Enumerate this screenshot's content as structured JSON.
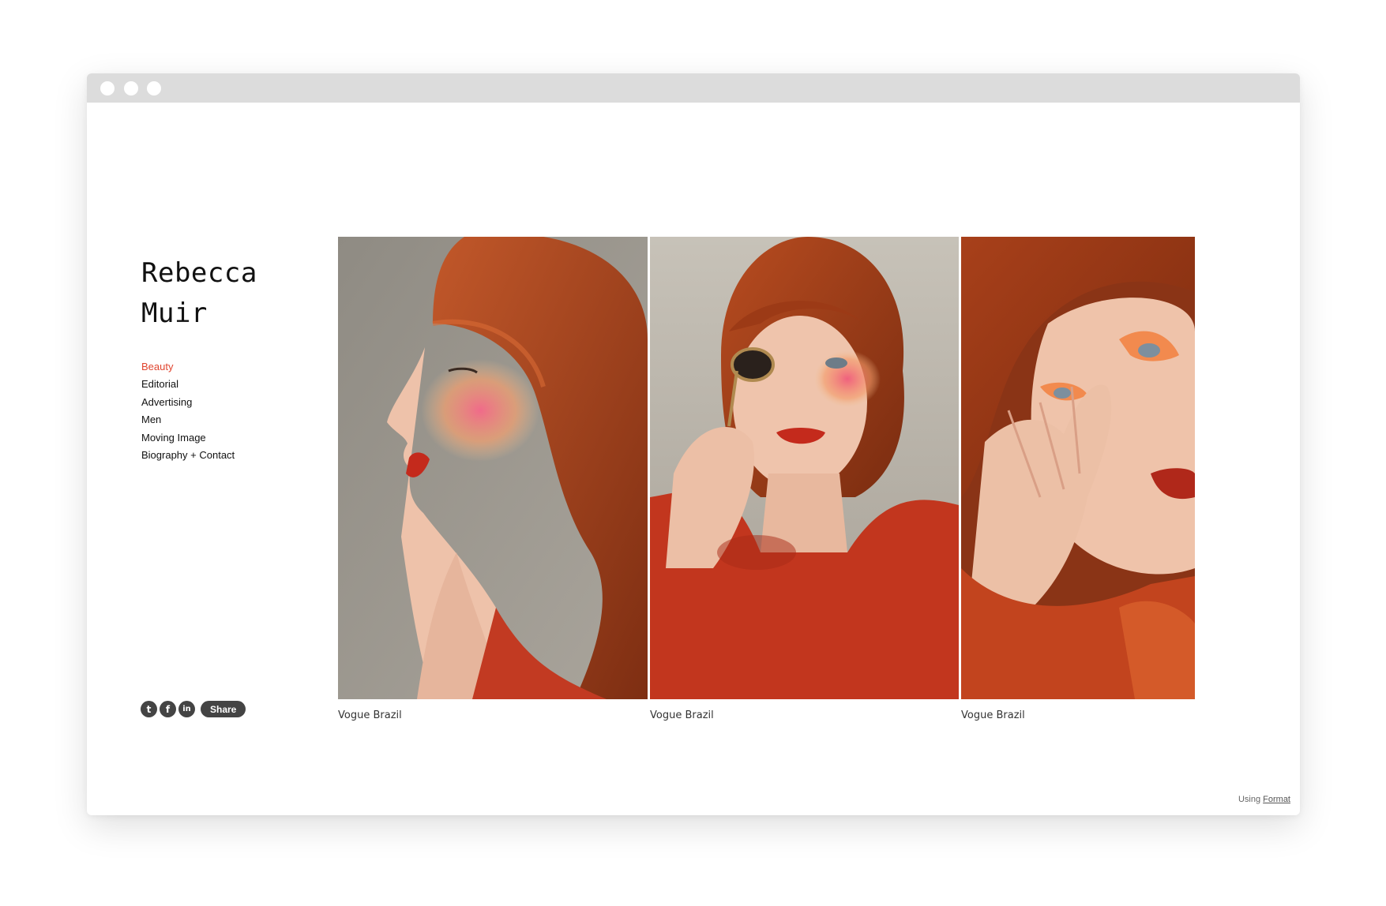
{
  "site": {
    "name_line1": "Rebecca",
    "name_line2": "Muir"
  },
  "nav": {
    "items": [
      {
        "label": "Beauty",
        "active": true
      },
      {
        "label": "Editorial"
      },
      {
        "label": "Advertising"
      },
      {
        "label": "Men"
      },
      {
        "label": "Moving Image"
      },
      {
        "label": "Biography + Contact"
      }
    ]
  },
  "social": {
    "twitter_glyph": "t",
    "facebook_glyph": "f",
    "linkedin_glyph": "in",
    "share_label": "Share"
  },
  "gallery": {
    "items": [
      {
        "caption": "Vogue Brazil"
      },
      {
        "caption": "Vogue Brazil"
      },
      {
        "caption": "Vogue Brazil"
      }
    ]
  },
  "footer": {
    "using_text": "Using",
    "format_link": "Format"
  },
  "colors": {
    "active_nav": "#e0452f",
    "hair": "#a54018",
    "lips": "#c42a1c",
    "backdrop": "#9a958c"
  }
}
